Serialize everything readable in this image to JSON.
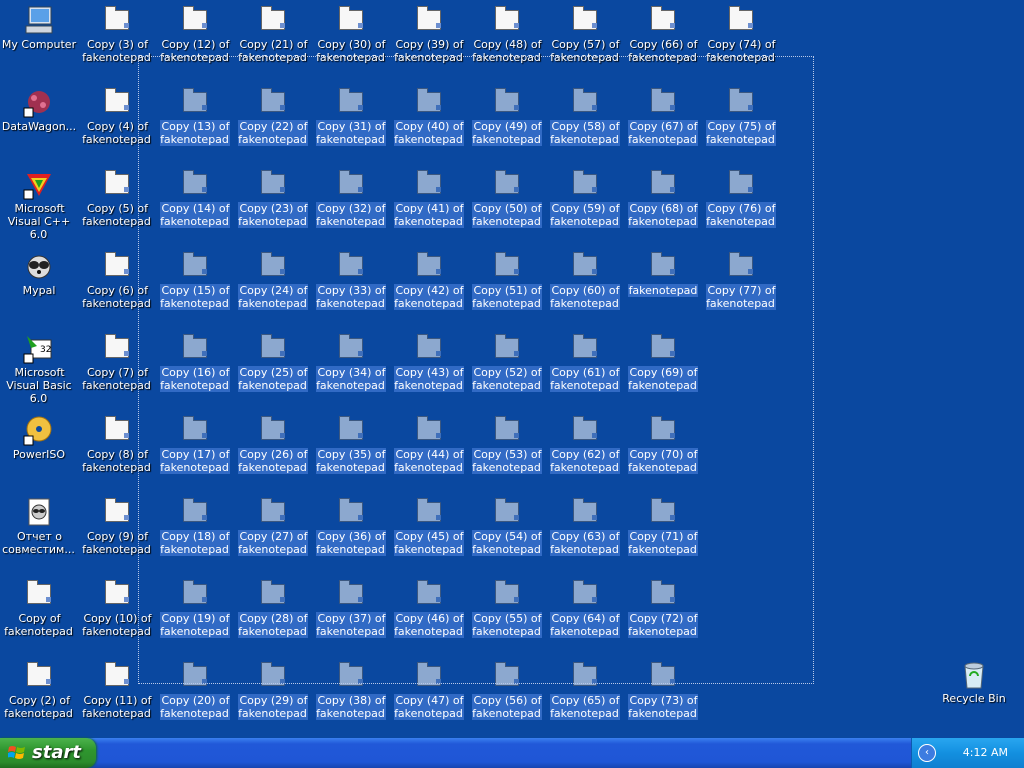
{
  "desktop": {
    "system_icons": [
      {
        "label": "My Computer",
        "icon": "computer-icon"
      },
      {
        "label": "DataWagon...",
        "icon": "datawagon-icon"
      },
      {
        "label": "Microsoft Visual C++ 6.0",
        "icon": "visual-cpp-icon"
      },
      {
        "label": "Mypal",
        "icon": "mypal-icon"
      },
      {
        "label": "Microsoft Visual Basic 6.0",
        "icon": "visual-basic-icon"
      },
      {
        "label": "PowerISO",
        "icon": "poweriso-icon"
      },
      {
        "label": "Отчет о совместим...",
        "icon": "report-icon"
      },
      {
        "label": "Copy of fakenotepad",
        "icon": "folder-icon"
      },
      {
        "label": "Copy (2) of fakenotepad",
        "icon": "folder-icon"
      }
    ],
    "column2": [
      "Copy (3) of fakenotepad",
      "Copy (4) of fakenotepad",
      "Copy (5) of fakenotepad",
      "Copy (6) of fakenotepad",
      "Copy (7) of fakenotepad",
      "Copy (8) of fakenotepad",
      "Copy (9) of fakenotepad",
      "Copy (10) of fakenotepad",
      "Copy (11) of fakenotepad"
    ],
    "grid_columns": [
      [
        "Copy (12) of fakenotepad",
        "Copy (13) of fakenotepad",
        "Copy (14) of fakenotepad",
        "Copy (15) of fakenotepad",
        "Copy (16) of fakenotepad",
        "Copy (17) of fakenotepad",
        "Copy (18) of fakenotepad",
        "Copy (19) of fakenotepad",
        "Copy (20) of fakenotepad"
      ],
      [
        "Copy (21) of fakenotepad",
        "Copy (22) of fakenotepad",
        "Copy (23) of fakenotepad",
        "Copy (24) of fakenotepad",
        "Copy (25) of fakenotepad",
        "Copy (26) of fakenotepad",
        "Copy (27) of fakenotepad",
        "Copy (28) of fakenotepad",
        "Copy (29) of fakenotepad"
      ],
      [
        "Copy (30) of fakenotepad",
        "Copy (31) of fakenotepad",
        "Copy (32) of fakenotepad",
        "Copy (33) of fakenotepad",
        "Copy (34) of fakenotepad",
        "Copy (35) of fakenotepad",
        "Copy (36) of fakenotepad",
        "Copy (37) of fakenotepad",
        "Copy (38) of fakenotepad"
      ],
      [
        "Copy (39) of fakenotepad",
        "Copy (40) of fakenotepad",
        "Copy (41) of fakenotepad",
        "Copy (42) of fakenotepad",
        "Copy (43) of fakenotepad",
        "Copy (44) of fakenotepad",
        "Copy (45) of fakenotepad",
        "Copy (46) of fakenotepad",
        "Copy (47) of fakenotepad"
      ],
      [
        "Copy (48) of fakenotepad",
        "Copy (49) of fakenotepad",
        "Copy (50) of fakenotepad",
        "Copy (51) of fakenotepad",
        "Copy (52) of fakenotepad",
        "Copy (53) of fakenotepad",
        "Copy (54) of fakenotepad",
        "Copy (55) of fakenotepad",
        "Copy (56) of fakenotepad"
      ],
      [
        "Copy (57) of fakenotepad",
        "Copy (58) of fakenotepad",
        "Copy (59) of fakenotepad",
        "Copy (60) of fakenotepad",
        "Copy (61) of fakenotepad",
        "Copy (62) of fakenotepad",
        "Copy (63) of fakenotepad",
        "Copy (64) of fakenotepad",
        "Copy (65) of fakenotepad"
      ],
      [
        "Copy (66) of fakenotepad",
        "Copy (67) of fakenotepad",
        "Copy (68) of fakenotepad",
        "fakenotepad",
        "Copy (69) of fakenotepad",
        "Copy (70) of fakenotepad",
        "Copy (71) of fakenotepad",
        "Copy (72) of fakenotepad",
        "Copy (73) of fakenotepad"
      ],
      [
        "Copy (74) of fakenotepad",
        "Copy (75) of fakenotepad",
        "Copy (76) of fakenotepad",
        "Copy (77) of fakenotepad"
      ]
    ],
    "recycle_bin": {
      "label": "Recycle Bin",
      "icon": "recycle-bin-icon"
    }
  },
  "taskbar": {
    "start_label": "start",
    "clock": "4:12 AM"
  },
  "colors": {
    "desktop_bg": "#0a48a0",
    "selection_bg": "#316ac5",
    "taskbar": "#1f56d6",
    "start_green": "#2f962f",
    "tray_blue": "#1390e0"
  }
}
